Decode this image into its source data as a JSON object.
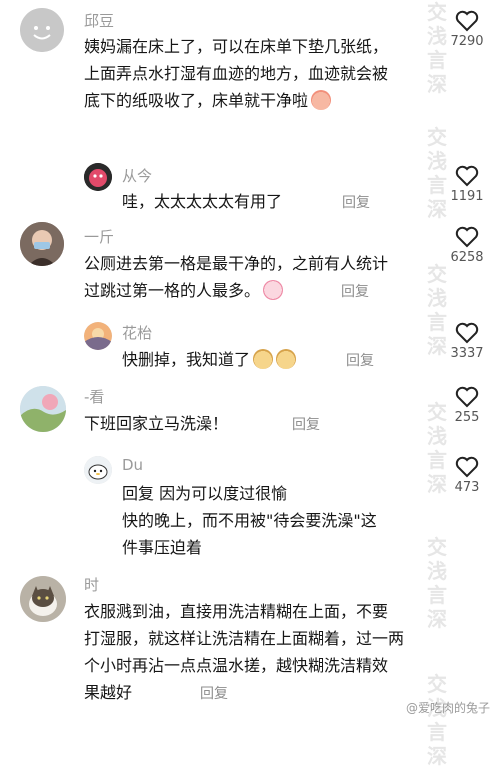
{
  "watermark": "交浅言深",
  "footer": "@爱吃肉的兔子",
  "comments": [
    {
      "name": "邱豆",
      "text_lines": [
        "姨妈漏在床上了，可以在床单下垫几张纸，",
        "上面弄点水打湿有血迹的地方，血迹就会被",
        "底下的纸吸收了，床单就干净啦"
      ],
      "likes": "7290"
    },
    {
      "name": "从今",
      "text": "哇，太太太太太有用了",
      "reply": "回复",
      "likes": "1191"
    },
    {
      "name": "一斤",
      "text_lines": [
        "公厕进去第一格是最干净的，之前有人统计",
        "过跳过第一格的人最多。"
      ],
      "reply": "回复",
      "likes": "6258"
    },
    {
      "name": "花枱",
      "text": "快删掉，我知道了",
      "reply": "回复",
      "likes": "3337"
    },
    {
      "name": "-看",
      "text": "下班回家立马洗澡！",
      "reply": "回复",
      "likes": "255"
    },
    {
      "name": "Du",
      "text_lines": [
        "回复                      因为可以度过很愉",
        "快的晚上，而不用被\"待会要洗澡\"这",
        "件事压迫着"
      ],
      "likes": "473"
    },
    {
      "name": "时",
      "text_lines": [
        "衣服溅到油，直接用洗洁精糊在上面，不要",
        "打湿服，就这样让洗洁精在上面糊着，过一两",
        "个小时再沾一点点温水搓，越快糊洗洁精效",
        "果越好"
      ],
      "reply": "回复"
    }
  ]
}
